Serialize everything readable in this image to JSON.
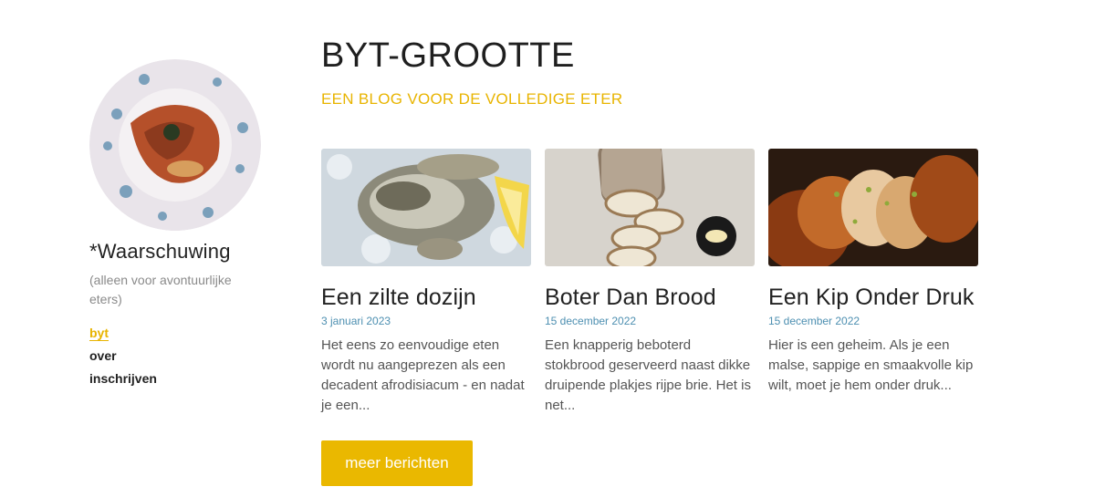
{
  "sidebar": {
    "title": "*Waarschuwing",
    "subtitle": "(alleen voor avontuurlijke eters)",
    "nav": [
      {
        "label": "byt"
      },
      {
        "label": "over"
      },
      {
        "label": "inschrijven"
      }
    ]
  },
  "main": {
    "title": "BYT-GROOTTE",
    "tagline": "EEN BLOG VOOR DE VOLLEDIGE ETER",
    "posts": [
      {
        "title": "Een zilte dozijn",
        "date": "3 januari 2023",
        "excerpt": "Het eens zo eenvoudige eten wordt nu aangeprezen als een decadent afrodisiacum - en nadat je een..."
      },
      {
        "title": "Boter Dan Brood",
        "date": "15 december 2022",
        "excerpt": "Een knapperig beboterd stokbrood geserveerd naast dikke druipende plakjes rijpe brie. Het is net..."
      },
      {
        "title": "Een Kip Onder Druk",
        "date": "15 december 2022",
        "excerpt": "Hier is een geheim. Als je een malse, sappige en smaakvolle kip wilt, moet je hem onder druk..."
      }
    ],
    "more_label": "meer berichten"
  },
  "colors": {
    "accent": "#eab800",
    "date": "#4d8fb1"
  }
}
